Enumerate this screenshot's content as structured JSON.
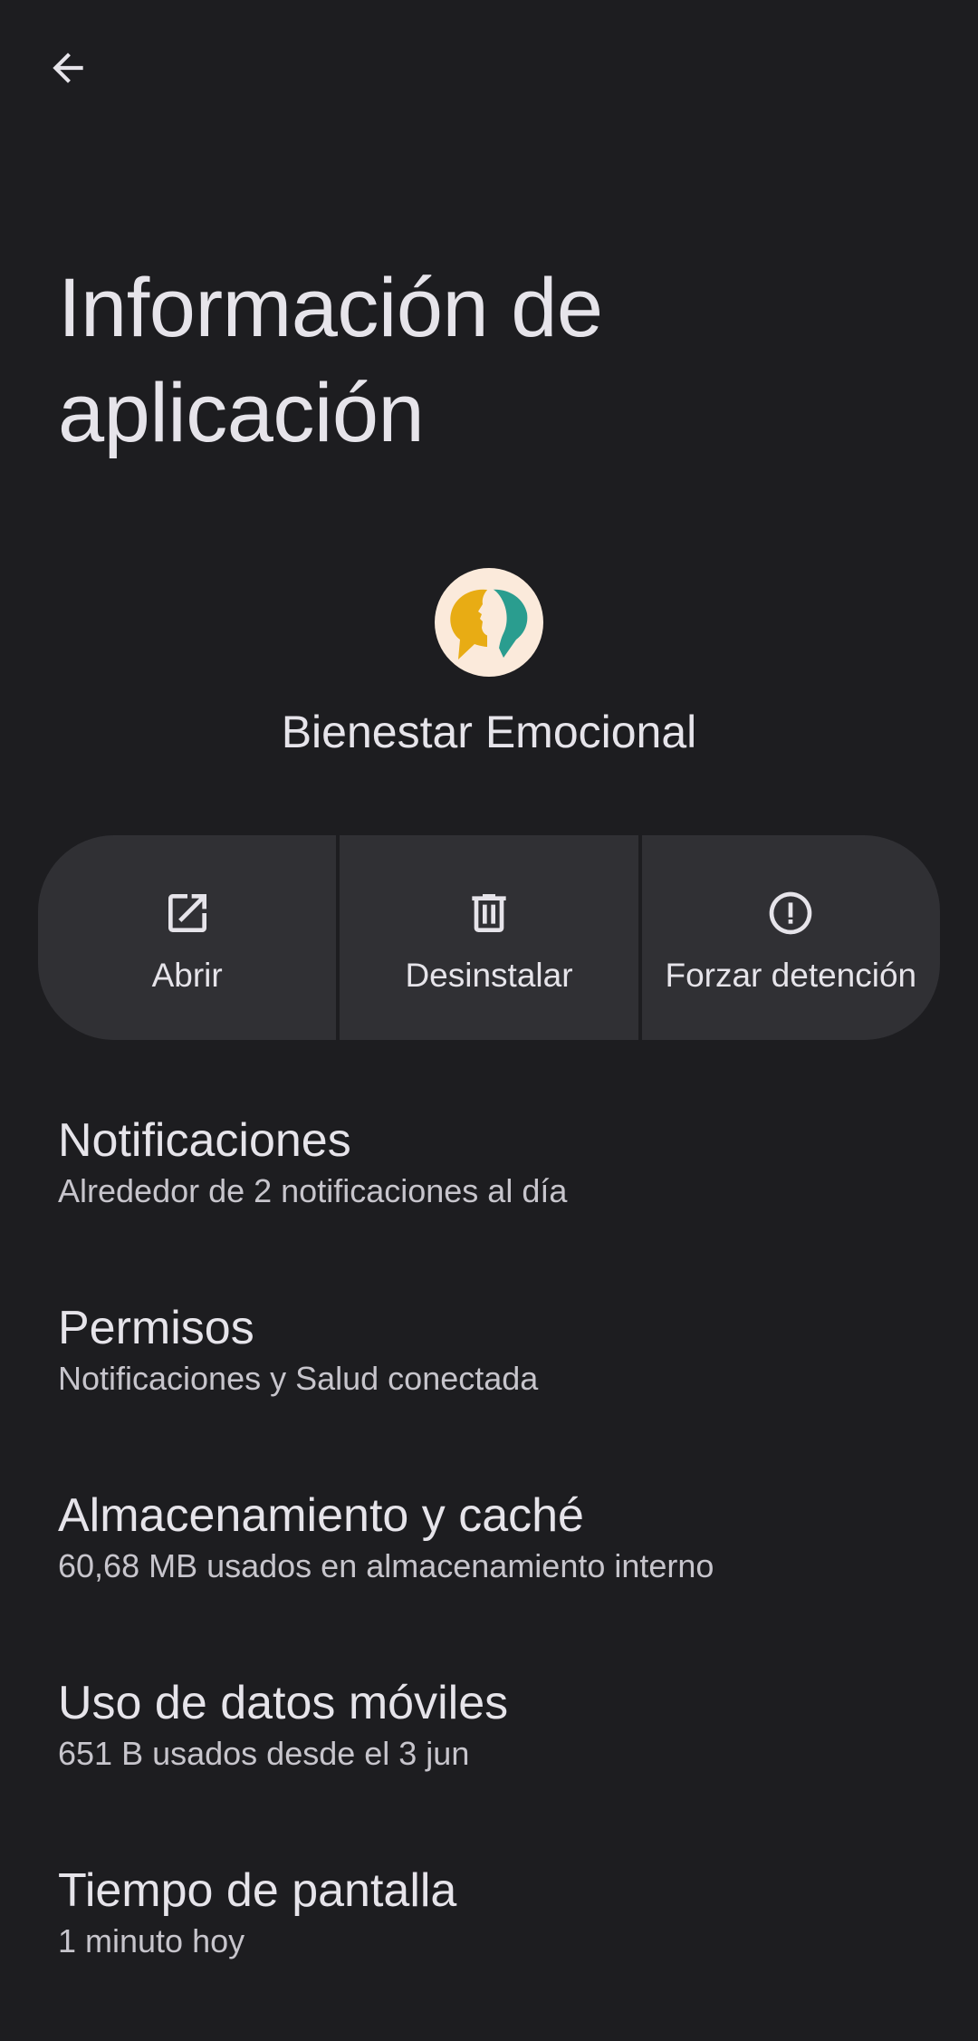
{
  "header": {
    "title": "Información de aplicación"
  },
  "app": {
    "name": "Bienestar Emocional",
    "icon": "bienestar-emocional-app-icon"
  },
  "actions": [
    {
      "label": "Abrir",
      "icon": "open-external-icon"
    },
    {
      "label": "Desinstalar",
      "icon": "trash-icon"
    },
    {
      "label": "Forzar detención",
      "icon": "force-stop-icon"
    }
  ],
  "settings": [
    {
      "title": "Notificaciones",
      "subtitle": "Alrededor de 2 notificaciones al día"
    },
    {
      "title": "Permisos",
      "subtitle": "Notificaciones y Salud conectada"
    },
    {
      "title": "Almacenamiento y caché",
      "subtitle": "60,68 MB usados en almacenamiento interno"
    },
    {
      "title": "Uso de datos móviles",
      "subtitle": "651 B usados desde el 3 jun"
    },
    {
      "title": "Tiempo de pantalla",
      "subtitle": "1 minuto hoy"
    }
  ],
  "colors": {
    "background": "#1d1d20",
    "button_surface": "#303034",
    "text_primary": "#e6e4ea",
    "text_secondary": "#c7c5cc",
    "icon_yellow": "#e8ac14",
    "icon_teal": "#2a9d8f"
  }
}
